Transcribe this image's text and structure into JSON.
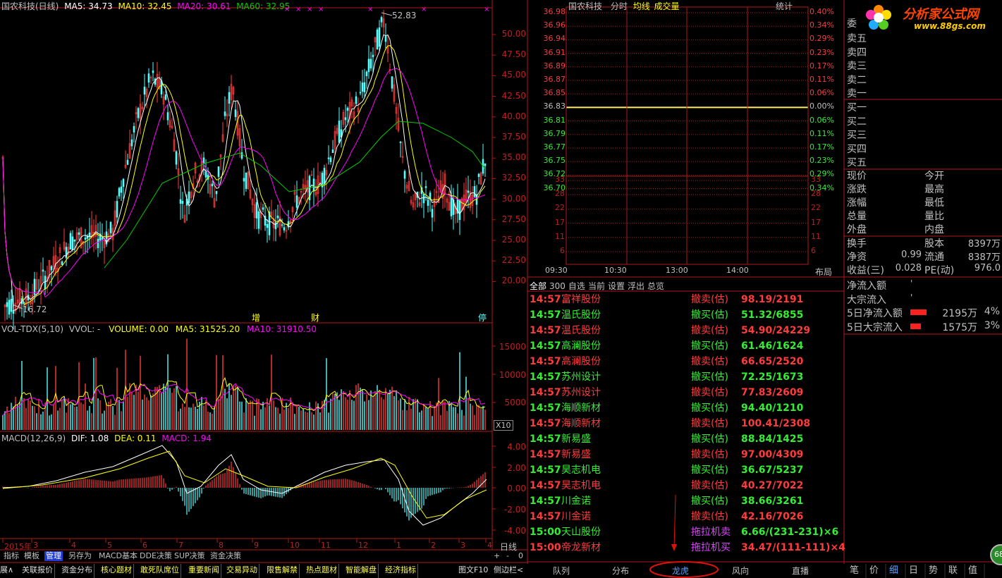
{
  "colors": {
    "up": "#ff3b3b",
    "down": "#55ffff",
    "ma5": "#ffffff",
    "ma10": "#ffff00",
    "ma20": "#ff00ff",
    "ma60": "#00cc00",
    "volma5": "#ffff00",
    "volma10": "#ff00ff",
    "dif": "#ffffff",
    "dea": "#ffff00",
    "axis": "#b01818",
    "green": "#33ee33",
    "red": "#ff3b3b",
    "purple": "#dd44ff"
  },
  "kline": {
    "title": "国农科技(日线)",
    "ma5": "MA5: 34.73",
    "ma10": "MA10: 32.45",
    "ma20": "MA20: 30.61",
    "ma60": "MA60: 32.95",
    "hi_label": "52.83",
    "lo_label": "16.72",
    "y_ticks": [
      "50.00",
      "47.50",
      "45.00",
      "42.50",
      "40.00",
      "37.50",
      "35.00",
      "32.50",
      "30.00",
      "27.50",
      "25.00",
      "22.50",
      "20.00"
    ],
    "markers": [
      "增",
      "财",
      "停"
    ],
    "marks": [
      "×",
      "×",
      "×",
      "×",
      "×",
      "×",
      "×"
    ]
  },
  "volume": {
    "title": "VOL-TDX(5,10)",
    "vvol": "VVOL: -",
    "volume": "VOLUME: 0.00",
    "ma5": "MA5: 31525.20",
    "ma10": "MA10: 31910.50",
    "ticks": [
      "15000",
      "10000",
      "5000"
    ],
    "unit": "X10"
  },
  "macd": {
    "title": "MACD(12,26,9)",
    "dif": "DIF: 1.08",
    "dea": "DEA: 0.11",
    "macd": "MACD: 1.94",
    "ticks": [
      "4.00",
      "2.00",
      "0.00",
      "-2.00",
      "-4.00"
    ]
  },
  "dates": [
    "2015年",
    "3",
    "4",
    "5",
    "6",
    "7",
    "8",
    "9",
    "10",
    "11",
    "12",
    "1",
    "2",
    "3",
    "4"
  ],
  "period": "日线",
  "toolbar": [
    "指标",
    "模板",
    "管理",
    "另存为",
    "MACD基本",
    "DDE决策",
    "SUP决策",
    "资金决策"
  ],
  "bottom_bar": [
    "展∧",
    "关联报价",
    "资金分布",
    "核心题材",
    "敢死队席位",
    "重要新闻",
    "交易异动",
    "限售解禁",
    "热点题材",
    "智能解盘",
    "经济指标"
  ],
  "bottom_right": [
    "图文F10",
    "侧边栏<"
  ],
  "plus": "+",
  "minus": "-",
  "zero": "0",
  "intraday": {
    "stock": "国农科技",
    "tabs": [
      "分时",
      "均线",
      "成交量"
    ],
    "stat": "统计",
    "prices": [
      "36.98",
      "36.96",
      "36.94",
      "36.91",
      "36.89",
      "36.87",
      "36.85",
      "36.83",
      "36.81",
      "36.79",
      "36.77",
      "36.75",
      "36.72",
      "36.70"
    ],
    "pcts": [
      "0.40%",
      "0.34%",
      "0.29%",
      "0.23%",
      "0.17%",
      "0.11%",
      "0.06%",
      "0.00%",
      "0.06%",
      "0.11%",
      "0.17%",
      "0.23%",
      "0.29%",
      "0.34%"
    ],
    "vol_ticks": [
      "33",
      "28",
      "22",
      "17",
      "11",
      "6"
    ],
    "times": [
      "09:30",
      "10:30",
      "13:00",
      "14:00"
    ],
    "layout": "布局"
  },
  "filter_tabs": [
    "全部",
    "300",
    "自选",
    "当前",
    "设置",
    "浮出",
    "总览"
  ],
  "monitor": [
    {
      "time": "14:57",
      "name": "富祥股份",
      "action": "撤卖(估)",
      "value": "98.19/2191",
      "c": "r"
    },
    {
      "time": "14:57",
      "name": "温氏股份",
      "action": "撤买(估)",
      "value": "51.32/6855",
      "c": "g"
    },
    {
      "time": "14:57",
      "name": "温氏股份",
      "action": "撤卖(估)",
      "value": "54.90/24229",
      "c": "r"
    },
    {
      "time": "14:57",
      "name": "高澜股份",
      "action": "撤买(估)",
      "value": "61.46/1624",
      "c": "g"
    },
    {
      "time": "14:57",
      "name": "高澜股份",
      "action": "撤卖(估)",
      "value": "66.65/2520",
      "c": "r"
    },
    {
      "time": "14:57",
      "name": "苏州设计",
      "action": "撤买(估)",
      "value": "72.25/1673",
      "c": "g"
    },
    {
      "time": "14:57",
      "name": "苏州设计",
      "action": "撤卖(估)",
      "value": "77.83/2609",
      "c": "r"
    },
    {
      "time": "14:57",
      "name": "海顺新材",
      "action": "撤买(估)",
      "value": "94.40/1210",
      "c": "g"
    },
    {
      "time": "14:57",
      "name": "海顺新材",
      "action": "撤卖(估)",
      "value": "100.41/2308",
      "c": "r"
    },
    {
      "time": "14:57",
      "name": "新易盛",
      "action": "撤买(估)",
      "value": "88.84/1425",
      "c": "g"
    },
    {
      "time": "14:57",
      "name": "新易盛",
      "action": "撤卖(估)",
      "value": "97.00/4309",
      "c": "r"
    },
    {
      "time": "14:57",
      "name": "昊志机电",
      "action": "撤买(估)",
      "value": "36.67/5237",
      "c": "g"
    },
    {
      "time": "14:57",
      "name": "昊志机电",
      "action": "撤卖(估)",
      "value": "40.27/7022",
      "c": "r"
    },
    {
      "time": "14:57",
      "name": "川金诺",
      "action": "撤买(估)",
      "value": "38.66/3261",
      "c": "g"
    },
    {
      "time": "14:57",
      "name": "川金诺",
      "action": "撤卖(估)",
      "value": "42.16/7026",
      "c": "r"
    },
    {
      "time": "15:00",
      "name": "天山股份",
      "action": "拖拉机卖",
      "value": "6.66/(231-231)×6",
      "c": "g"
    },
    {
      "time": "15:00",
      "name": "帝龙新材",
      "action": "拖拉机买",
      "value": "34.47/(111-111)×4",
      "c": "r"
    }
  ],
  "middle_tabs": [
    "队列",
    "分布",
    "龙虎",
    "风向",
    "直播"
  ],
  "orderbook": {
    "wei": "委",
    "sell": [
      "卖五",
      "卖四",
      "卖三",
      "卖二",
      "卖一"
    ],
    "buy": [
      "买一",
      "买二",
      "买三",
      "买四",
      "买五"
    ]
  },
  "quote_labels": [
    [
      "现价",
      "今开"
    ],
    [
      "涨跌",
      "最高"
    ],
    [
      "涨幅",
      "最低"
    ],
    [
      "总量",
      "量比"
    ],
    [
      "外盘",
      "内盘"
    ]
  ],
  "stats": [
    {
      "k1": "换手",
      "v1": "",
      "k2": "股本",
      "v2": "8397万"
    },
    {
      "k1": "净资",
      "v1": "0.99",
      "k2": "流通",
      "v2": "8387万"
    },
    {
      "k1": "收益(三)",
      "v1": "0.028",
      "k2": "PE(动)",
      "v2": "976.0"
    }
  ],
  "flow": [
    {
      "label": "净流入额",
      "tick": "'"
    },
    {
      "label": "大宗流入",
      "tick": "'"
    },
    {
      "label": "5日净流入额",
      "value": "2195万",
      "pct": "4%",
      "bar": 0.7
    },
    {
      "label": "5日大宗流入",
      "value": "1575万",
      "pct": "3%",
      "bar": 0.45
    }
  ],
  "right_tabs": [
    "笔",
    "价",
    "细",
    "日",
    "势",
    "联",
    "值"
  ],
  "logo": {
    "text": "分析家公式网",
    "url": "www.88gs.com"
  },
  "badge": "68"
}
